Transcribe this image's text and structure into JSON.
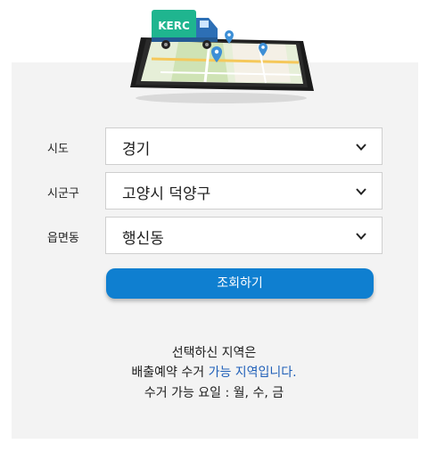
{
  "hero": {
    "truck_badge": "KERC"
  },
  "form": {
    "rows": [
      {
        "label": "시도",
        "value": "경기"
      },
      {
        "label": "시군구",
        "value": "고양시 덕양구"
      },
      {
        "label": "읍면동",
        "value": "행신동"
      }
    ],
    "submit_label": "조회하기"
  },
  "result": {
    "line1": "선택하신 지역은",
    "line2_prefix": "배출예약 수거 ",
    "line2_highlight": "가능 지역입니다.",
    "line3": "수거 가능 요일 : 월, 수, 금"
  },
  "colors": {
    "accent": "#0f7fd0",
    "highlight_text": "#1f5fb8",
    "panel_bg": "#f3f3f3"
  }
}
